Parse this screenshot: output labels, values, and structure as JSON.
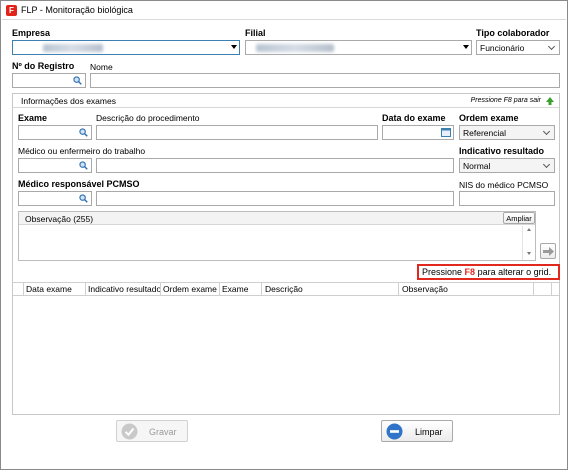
{
  "window": {
    "title": "FLP - Monitoração biológica"
  },
  "header": {
    "empresa_label": "Empresa",
    "filial_label": "Filial",
    "tipo_colaborador_label": "Tipo colaborador",
    "tipo_colaborador_value": "Funcionário",
    "registro_label": "Nº do Registro",
    "nome_label": "Nome"
  },
  "exames": {
    "group_title": "Informações dos exames",
    "hint": "Pressione F8 para sair",
    "exame_label": "Exame",
    "descricao_label": "Descrição do procedimento",
    "data_label": "Data do exame",
    "ordem_label": "Ordem exame",
    "ordem_value": "Referencial",
    "medico_label": "Médico ou enfermeiro do trabalho",
    "indicativo_label": "Indicativo resultado",
    "indicativo_value": "Normal",
    "pcmso_label": "Médico responsável PCMSO",
    "nis_label": "NIS do médico PCMSO",
    "observacao_label": "Observação (255)",
    "ampliar_label": "Ampliar"
  },
  "notice": {
    "prefix": "Pressione",
    "key": "F8",
    "suffix": "para alterar o grid."
  },
  "grid": {
    "columns": [
      "Data exame",
      "Indicativo resultado",
      "Ordem exame",
      "Exame",
      "Descrição",
      "Observação"
    ]
  },
  "footer": {
    "gravar_label": "Gravar",
    "limpar_label": "Limpar"
  },
  "colors": {
    "notice_border": "#e0281f",
    "notice_key": "#e0281f",
    "accent_blue": "#3c7fb1"
  }
}
